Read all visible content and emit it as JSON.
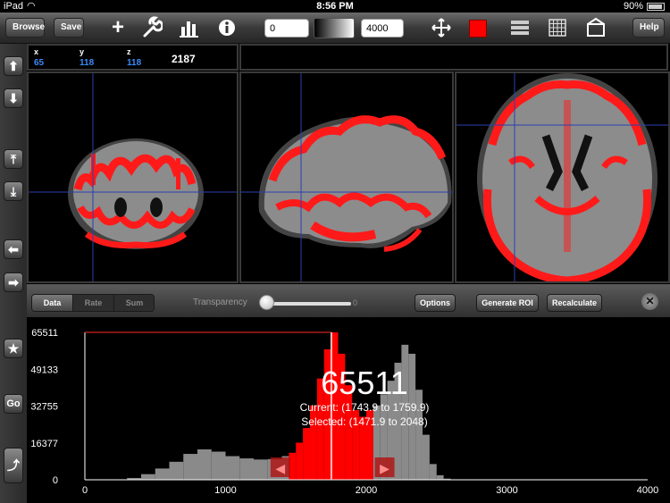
{
  "status_bar": {
    "device": "iPad",
    "time": "8:56 PM",
    "battery": "90%",
    "wifi_icon": "wifi-icon",
    "battery_icon": "battery-icon"
  },
  "toolbar": {
    "browse_label": "Browse",
    "save_label": "Save",
    "min_value": "0",
    "max_value": "4000",
    "help_label": "Help",
    "overlay_color": "#ff0000",
    "icons": [
      "plus-icon",
      "wrench-icon",
      "bar-chart-icon",
      "info-icon",
      "move-icon",
      "layers-icon",
      "grid-icon",
      "tray-icon"
    ]
  },
  "sidebar": {
    "go_label": "Go",
    "icons": [
      "arrow-up-icon",
      "arrow-down-icon",
      "arrow-up-bar-icon",
      "arrow-down-bar-icon",
      "arrow-left-icon",
      "arrow-right-icon",
      "star-icon",
      "rotate-icon"
    ]
  },
  "coordinates": {
    "x_label": "x",
    "x_value": "65",
    "y_label": "y",
    "y_value": "118",
    "z_label": "z",
    "z_value": "118",
    "intensity": "2187"
  },
  "histogram_panel": {
    "tabs": [
      "Data",
      "Rate",
      "Sum"
    ],
    "active_tab": "Data",
    "transparency_label": "Transparency",
    "transparency_value": "0",
    "options_label": "Options",
    "generate_roi_label": "Generate ROI",
    "recalculate_label": "Recalculate",
    "peak_count": "65511",
    "current_range": "Current: (1743.9 to 1759.9)",
    "selected_range": "Selected: (1471.9 to 2048)"
  },
  "chart_data": {
    "type": "bar",
    "xlim": [
      0,
      4000
    ],
    "ylim": [
      0,
      65511
    ],
    "x_ticks": [
      "0",
      "1000",
      "2000",
      "3000",
      "4000"
    ],
    "y_ticks": [
      "0",
      "16377",
      "32755",
      "49133",
      "65511"
    ],
    "selection": [
      1471.9,
      2048
    ],
    "current": [
      1743.9,
      1759.9
    ],
    "colors": {
      "bars": "#8a8a8a",
      "selected": "#ff0000",
      "current": "#ffbbbb"
    },
    "series": [
      {
        "x": [
          200,
          300,
          400,
          500,
          600,
          700,
          800,
          900,
          1000,
          1100,
          1200,
          1300,
          1400,
          1450,
          1500,
          1550,
          1600,
          1650,
          1700,
          1750,
          1800,
          1850,
          1900,
          1950,
          2000,
          2050,
          2100,
          2150,
          2200,
          2250,
          2300,
          2350,
          2400,
          2450,
          2500,
          2550,
          2600,
          2700
        ],
        "values": [
          0,
          800,
          2500,
          5000,
          8000,
          11500,
          13500,
          12500,
          10500,
          9500,
          9000,
          9200,
          10500,
          12000,
          16500,
          23000,
          33000,
          45000,
          58000,
          65511,
          56000,
          42000,
          31000,
          28000,
          31000,
          33000,
          38000,
          44000,
          52000,
          60000,
          56000,
          40000,
          20000,
          7000,
          2000,
          500,
          100,
          0
        ]
      }
    ]
  }
}
